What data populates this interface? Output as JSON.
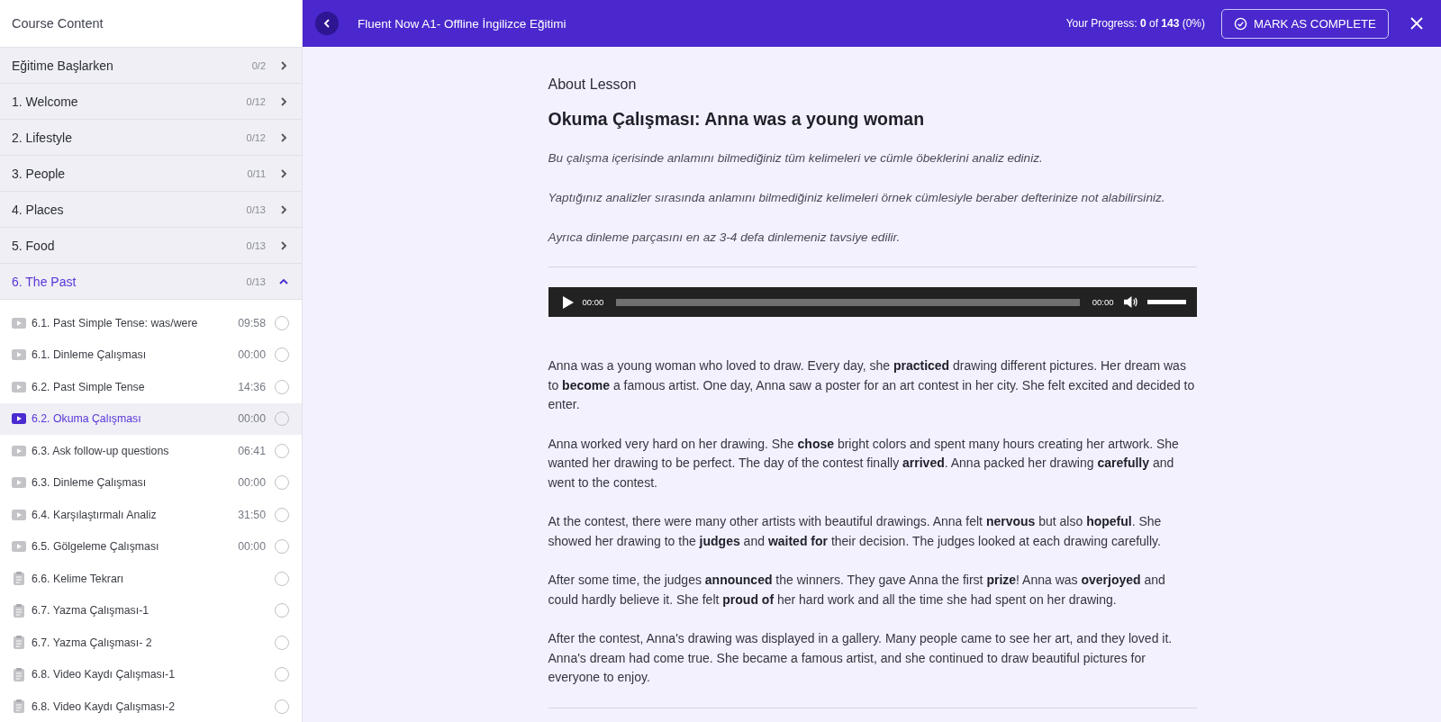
{
  "sidebar": {
    "title": "Course Content",
    "sections": [
      {
        "title": "Eğitime Başlarken",
        "count": "0/2",
        "expanded": false
      },
      {
        "title": "1. Welcome",
        "count": "0/12",
        "expanded": false
      },
      {
        "title": "2. Lifestyle",
        "count": "0/12",
        "expanded": false
      },
      {
        "title": "3. People",
        "count": "0/11",
        "expanded": false
      },
      {
        "title": "4. Places",
        "count": "0/13",
        "expanded": false
      },
      {
        "title": "5. Food",
        "count": "0/13",
        "expanded": false
      },
      {
        "title": "6. The Past",
        "count": "0/13",
        "expanded": true,
        "lessons": [
          {
            "kind": "video",
            "title": "6.1. Past Simple Tense: was/were",
            "duration": "09:58",
            "selected": false,
            "completed": false
          },
          {
            "kind": "video",
            "title": "6.1. Dinleme Çalışması",
            "duration": "00:00",
            "selected": false,
            "completed": false
          },
          {
            "kind": "video",
            "title": "6.2. Past Simple Tense",
            "duration": "14:36",
            "selected": false,
            "completed": false
          },
          {
            "kind": "video",
            "title": "6.2. Okuma Çalışması",
            "duration": "00:00",
            "selected": true,
            "completed": false
          },
          {
            "kind": "video",
            "title": "6.3. Ask follow-up questions",
            "duration": "06:41",
            "selected": false,
            "completed": false
          },
          {
            "kind": "video",
            "title": "6.3. Dinleme Çalışması",
            "duration": "00:00",
            "selected": false,
            "completed": false
          },
          {
            "kind": "video",
            "title": "6.4. Karşılaştırmalı Analiz",
            "duration": "31:50",
            "selected": false,
            "completed": false
          },
          {
            "kind": "video",
            "title": "6.5. Gölgeleme Çalışması",
            "duration": "00:00",
            "selected": false,
            "completed": false
          },
          {
            "kind": "document",
            "title": "6.6. Kelime Tekrarı",
            "selected": false,
            "completed": false
          },
          {
            "kind": "document",
            "title": "6.7. Yazma Çalışması-1",
            "selected": false,
            "completed": false
          },
          {
            "kind": "document",
            "title": "6.7. Yazma Çalışması- 2",
            "selected": false,
            "completed": false
          },
          {
            "kind": "document",
            "title": "6.8. Video Kaydı Çalışması-1",
            "selected": false,
            "completed": false
          },
          {
            "kind": "document",
            "title": "6.8. Video Kaydı Çalışması-2",
            "selected": false,
            "completed": false
          }
        ]
      }
    ]
  },
  "header": {
    "course_title": "Fluent Now A1- Offline İngilizce Eğitimi",
    "progress": "Your Progress: **0** of **143** (0%)",
    "mark_button": "MARK AS COMPLETE"
  },
  "lesson": {
    "label": "About Lesson",
    "title": "Okuma Çalışması: Anna was a young woman",
    "instructions": [
      "Bu çalışma içerisinde anlamını bilmediğiniz tüm kelimeleri ve cümle öbeklerini analiz ediniz.",
      "Yaptığınız analizler sırasında anlamını bilmediğiniz kelimeleri örnek cümlesiyle beraber defterinize not alabilirsiniz.",
      "Ayrıca dinleme parçasını en az 3-4 defa dinlemeniz tavsiye edilir."
    ],
    "audio": {
      "current_time": "00:00",
      "duration": "00:00",
      "level": 0,
      "volume": {
        "level": 1
      }
    },
    "paragraphs": [
      "Anna was a young woman who loved to draw. Every day, she **practiced** drawing different pictures. Her dream was to **become** a famous artist. One day, Anna saw a poster for an art contest in her city. She felt excited and decided to enter.",
      "Anna worked very hard on her drawing. She **chose** bright colors and spent many hours creating her artwork. She wanted her drawing to be perfect. The day of the contest finally **arrived**. Anna packed her drawing **carefully** and went to the contest.",
      "At the contest, there were many other artists with beautiful drawings. Anna felt **nervous** but also **hopeful**. She showed her drawing to the **judges** and **waited for** their decision. The judges looked at each drawing carefully.",
      "After some time, the judges **announced** the winners. They gave Anna the first **prize**! Anna was **overjoyed** and could hardly believe it. She felt **proud of** her hard work and all the time she had spent on her drawing.",
      "After the contest, Anna's drawing was displayed in a gallery. Many people came to see her art, and they loved it. Anna's dream had come true. She became a famous artist, and she continued to draw beautiful pictures for everyone to enjoy."
    ]
  }
}
